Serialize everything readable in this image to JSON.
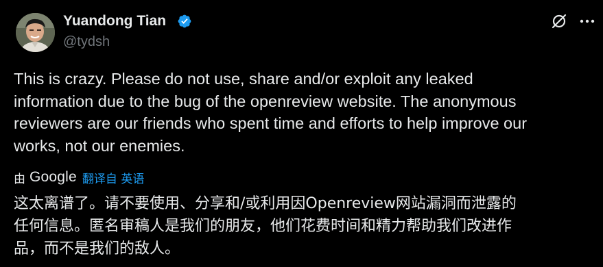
{
  "author": {
    "display_name": "Yuandong Tian",
    "handle": "@tydsh",
    "avatar_icon": "user-avatar",
    "verified_icon": "verified-badge-icon",
    "verified_color": "#1d9bf0"
  },
  "actions": {
    "grok_icon": "grok-icon",
    "more_icon": "more-options-icon"
  },
  "tweet": {
    "text": "This is crazy. Please do not use, share and/or exploit any leaked\ninformation due to the bug of the openreview website. The anonymous\nreviewers are our friends who spent time and efforts to help improve our\nworks, not our enemies."
  },
  "translation": {
    "by_label": "由",
    "provider": "Google",
    "link_label": "翻译自 英语",
    "link_color": "#1d9bf0",
    "text": "这太离谱了。请不要使用、分享和/或利用因Openreview网站漏洞而泄露的\n任何信息。匿名审稿人是我们的朋友，他们花费时间和精力帮助我们改进作\n品，而不是我们的敌人。"
  }
}
